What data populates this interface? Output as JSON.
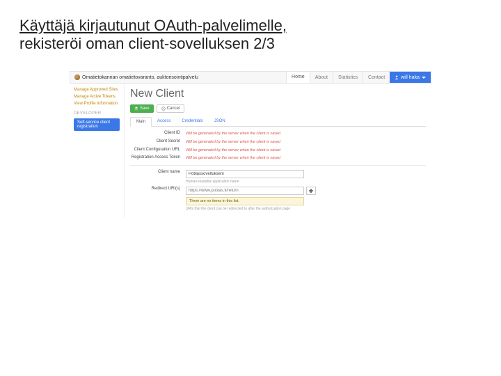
{
  "slide": {
    "title_line1": "Käyttäjä kirjautunut OAuth-palvelimelle,",
    "title_line2": "rekisteröi oman client-sovelluksen 2/3"
  },
  "topbar": {
    "brand": "Omatietokannan omatietovaranto, auktorisointipalvelu",
    "nav": {
      "home": "Home",
      "about": "About",
      "statistics": "Statistics",
      "contact": "Contact"
    },
    "user": "will haka"
  },
  "sidebar": {
    "links": {
      "manage_sites": "Manage Approved Sites",
      "manage_tokens": "Manage Active Tokens",
      "view_profile": "View Profile Information"
    },
    "group_label": "DEVELOPER",
    "selfservice": "Self-service client registration"
  },
  "page": {
    "heading": "New Client",
    "save_label": "Save",
    "cancel_label": "Cancel",
    "tabs": {
      "main": "Main",
      "access": "Access",
      "credentials": "Credentials",
      "json": "JSON"
    },
    "fields": {
      "client_id": {
        "label": "Client ID",
        "note": "Will be generated by the server when the client is saved"
      },
      "client_secret": {
        "label": "Client Secret",
        "note": "Will be generated by the server when the client is saved"
      },
      "config_url": {
        "label": "Client Configuration URL",
        "note": "Will be generated by the server when the client is saved"
      },
      "reg_token": {
        "label": "Registration Access Token",
        "note": "Will be generated by the server when the client is saved"
      },
      "client_name": {
        "label": "Client name",
        "value": "Potilassovellukseni",
        "hint": "Human-readable application name"
      },
      "redirect": {
        "label": "Redirect URI(s)",
        "placeholder": "https://www.potilas.fi/return",
        "empty": "There are no items in this list.",
        "hint": "URIs that the client can be redirected to after the authorization page"
      }
    }
  }
}
